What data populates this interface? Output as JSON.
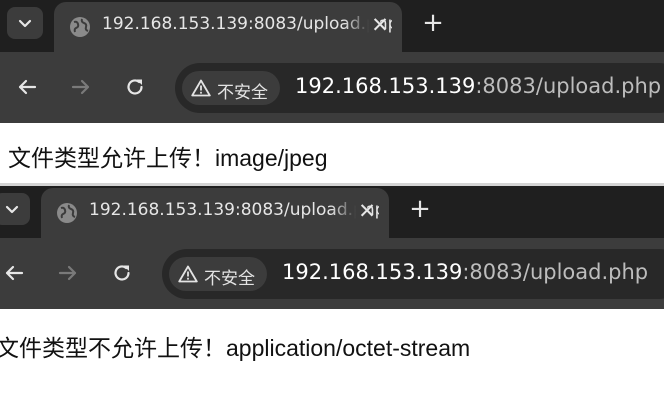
{
  "windows": [
    {
      "tab_title": "192.168.153.139:8083/upload.php",
      "security_label": "不安全",
      "url_host": "192.168.153.139",
      "url_rest": ":8083/upload.php",
      "message": "文件类型允许上传！image/jpeg"
    },
    {
      "tab_title": "192.168.153.139:8083/upload.php",
      "security_label": "不安全",
      "url_host": "192.168.153.139",
      "url_rest": ":8083/upload.php",
      "message": "文件类型不允许上传！application/octet-stream"
    }
  ],
  "icons": {
    "tab_search": "chevron-down-icon",
    "favicon": "globe-icon",
    "close": "close-icon",
    "new_tab": "plus-icon",
    "back": "arrow-left-icon",
    "forward": "arrow-right-icon",
    "reload": "reload-icon",
    "security": "warning-icon"
  },
  "colors": {
    "tabstrip": "#1f1f1f",
    "toolbar": "#3c3c3c",
    "omnibox": "#282828",
    "page": "#ffffff"
  }
}
